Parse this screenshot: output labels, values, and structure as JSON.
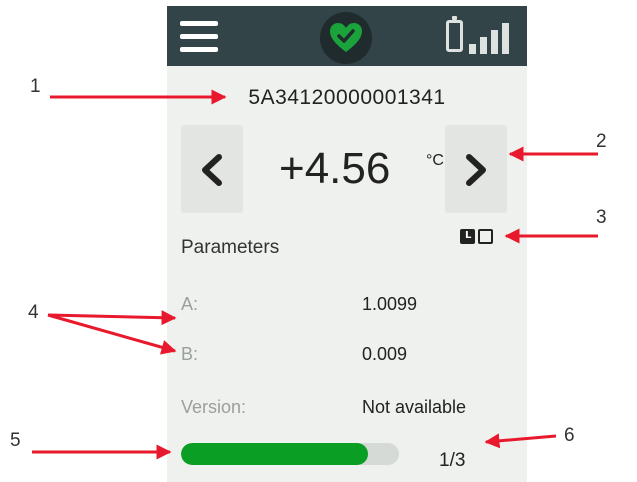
{
  "device": {
    "serial_number": "5A34120000001341",
    "temperature": {
      "value": "+4.56",
      "unit": "°C"
    },
    "status_icon": "heart-check-icon",
    "colors": {
      "header_bg": "#324448",
      "status_green": "#1aa33a",
      "progress_green": "#0a9f24",
      "screen_bg": "#eff1ee"
    },
    "parameters": {
      "title": "Parameters",
      "rows": [
        {
          "label": "A:",
          "value": "1.0099"
        },
        {
          "label": "B:",
          "value": "0.009"
        },
        {
          "label": "Version:",
          "value": "Not available"
        }
      ]
    },
    "progress": {
      "fraction": 0.86,
      "page_counter": "1/3"
    }
  },
  "callouts": {
    "colors": {
      "arrow": "#e8192c"
    },
    "labels": [
      "1",
      "2",
      "3",
      "4",
      "5",
      "6"
    ]
  }
}
